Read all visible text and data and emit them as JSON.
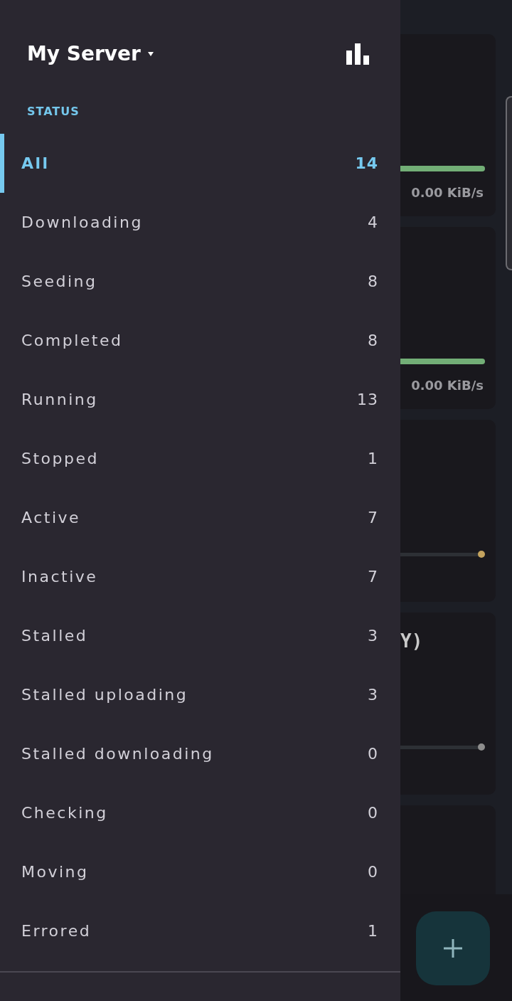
{
  "drawer": {
    "server": {
      "name": "My Server"
    },
    "section_label": "STATUS",
    "status_filters": [
      {
        "label": "All",
        "count": "14",
        "selected": true
      },
      {
        "label": "Downloading",
        "count": "4",
        "selected": false
      },
      {
        "label": "Seeding",
        "count": "8",
        "selected": false
      },
      {
        "label": "Completed",
        "count": "8",
        "selected": false
      },
      {
        "label": "Running",
        "count": "13",
        "selected": false
      },
      {
        "label": "Stopped",
        "count": "1",
        "selected": false
      },
      {
        "label": "Active",
        "count": "7",
        "selected": false
      },
      {
        "label": "Inactive",
        "count": "7",
        "selected": false
      },
      {
        "label": "Stalled",
        "count": "3",
        "selected": false
      },
      {
        "label": "Stalled uploading",
        "count": "3",
        "selected": false
      },
      {
        "label": "Stalled downloading",
        "count": "0",
        "selected": false
      },
      {
        "label": "Checking",
        "count": "0",
        "selected": false
      },
      {
        "label": "Moving",
        "count": "0",
        "selected": false
      },
      {
        "label": "Errored",
        "count": "1",
        "selected": false
      }
    ]
  },
  "torrent_cards": [
    {
      "progress": {
        "kind": "fill",
        "color": "#72ae76"
      },
      "speed": "0.00 KiB/s"
    },
    {
      "progress": {
        "kind": "fill",
        "color": "#72ae76"
      },
      "speed": "0.00 KiB/s"
    },
    {
      "progress": {
        "kind": "dot",
        "color": "#c4a35e"
      }
    },
    {
      "name": "Y)",
      "progress": {
        "kind": "dot",
        "color": "#8d8d8d"
      }
    }
  ]
}
